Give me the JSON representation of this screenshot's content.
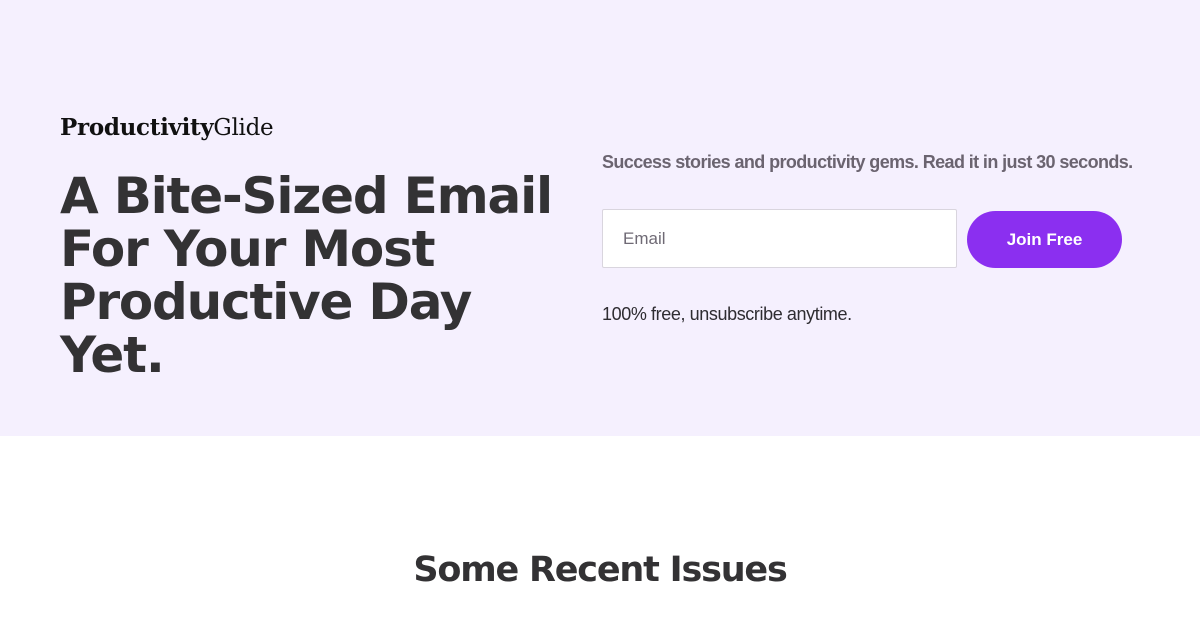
{
  "brand": {
    "name_bold": "Productivity",
    "name_light": "Glide"
  },
  "hero": {
    "headline_lines": [
      "A Bite-Sized Email",
      "For Your Most",
      "Productive Day Yet."
    ],
    "tagline": "Success stories and productivity gems. Read it in just 30 seconds.",
    "email_placeholder": "Email",
    "join_label": "Join Free",
    "fineprint": "100% free, unsubscribe anytime."
  },
  "recent": {
    "title": "Some Recent Issues"
  },
  "colors": {
    "hero_background": "#f5f0fe",
    "accent": "#8b2ff0",
    "heading_text": "#333234",
    "muted_text": "#6b6470"
  }
}
